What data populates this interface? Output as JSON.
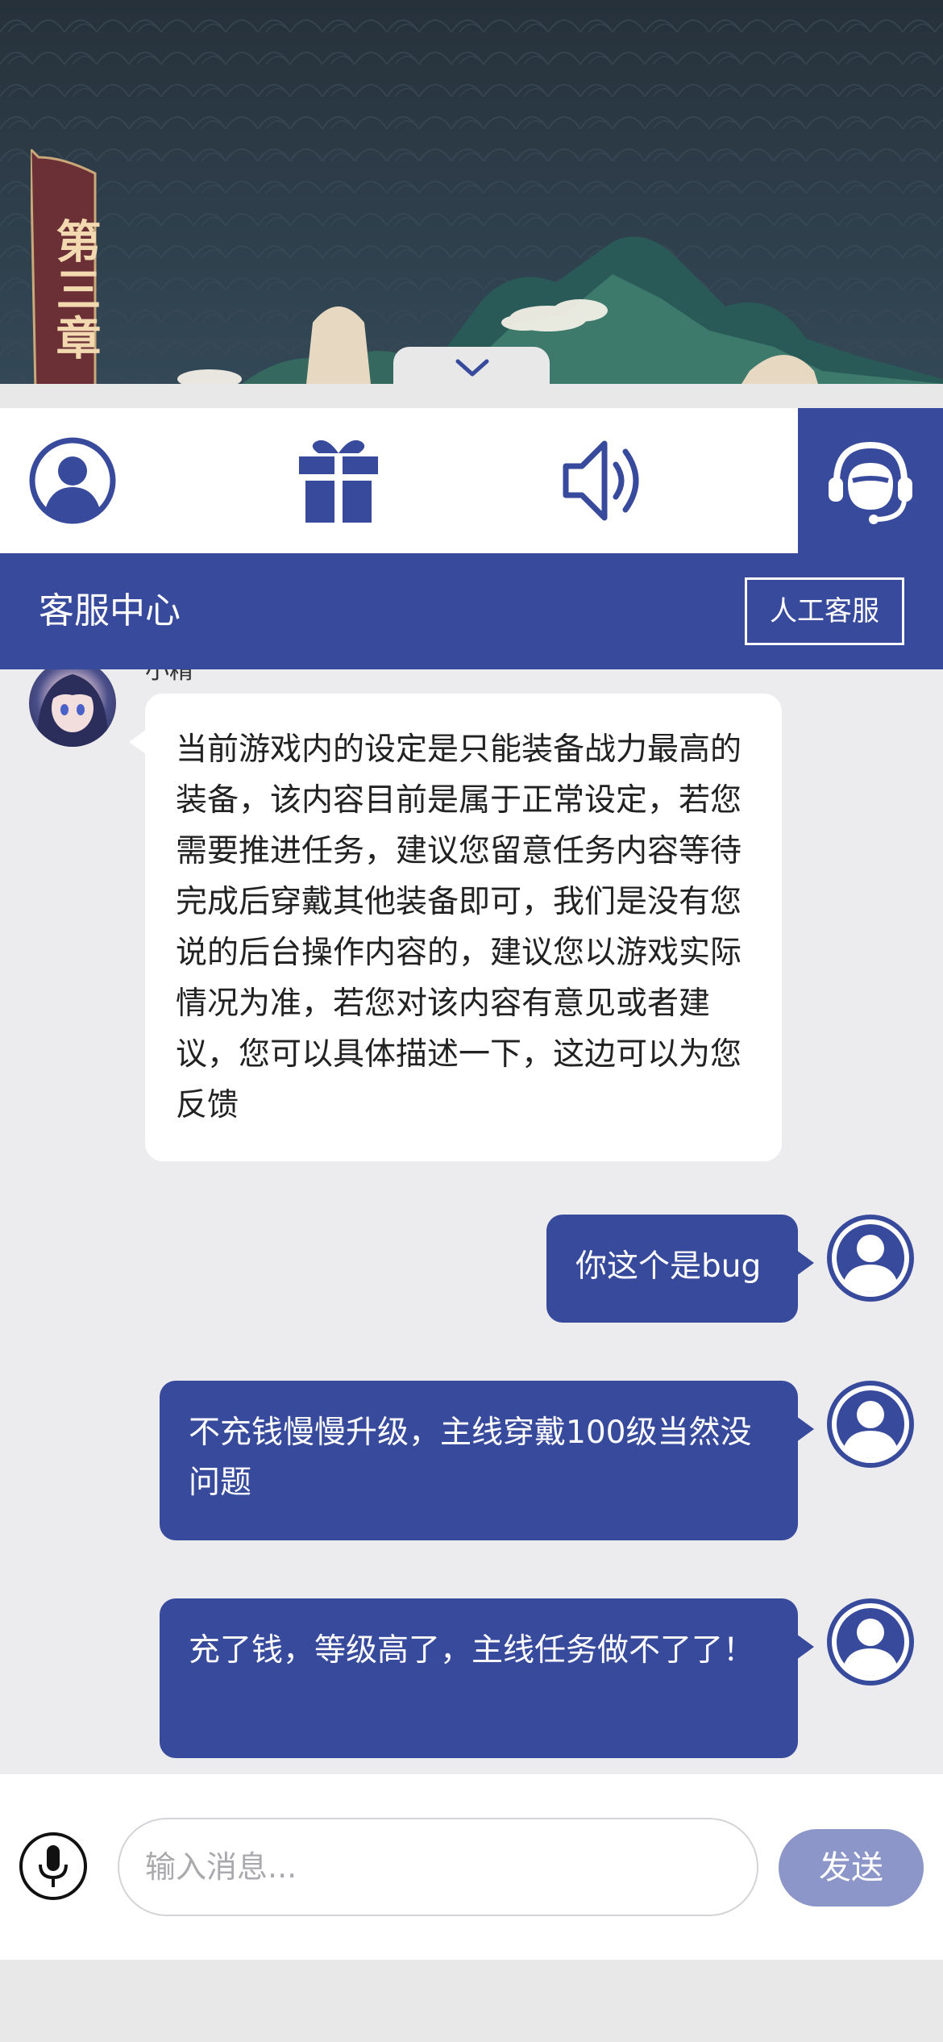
{
  "banner": {
    "chapter_text": "第三章",
    "collapse_icon": "chevron-down-icon"
  },
  "toolbar": {
    "items": [
      {
        "icon": "user-profile-icon"
      },
      {
        "icon": "gift-icon"
      },
      {
        "icon": "speaker-icon"
      },
      {
        "icon": "customer-service-icon"
      }
    ],
    "active_color": "#384a9c"
  },
  "header": {
    "title": "客服中心",
    "human_service_label": "人工客服"
  },
  "chat": {
    "agent_name": "小精",
    "agent_message": "当前游戏内的设定是只能装备战力最高的装备，该内容目前是属于正常设定，若您需要推进任务，建议您留意任务内容等待完成后穿戴其他装备即可，我们是没有您说的后台操作内容的，建议您以游戏实际情况为准，若您对该内容有意见或者建议，您可以具体描述一下，这边可以为您反馈",
    "user_messages": [
      {
        "text": "你这个是bug"
      },
      {
        "text": "不充钱慢慢升级，主线穿戴100级当然没问题"
      },
      {
        "text": "充了钱，等级高了，主线任务做不了了！"
      }
    ]
  },
  "input_bar": {
    "placeholder": "输入消息...",
    "value": "",
    "send_label": "发送",
    "mic_icon": "microphone-icon"
  },
  "colors": {
    "primary": "#384a9c",
    "send_disabled": "#8c96c8",
    "chat_bg": "#ececef"
  }
}
